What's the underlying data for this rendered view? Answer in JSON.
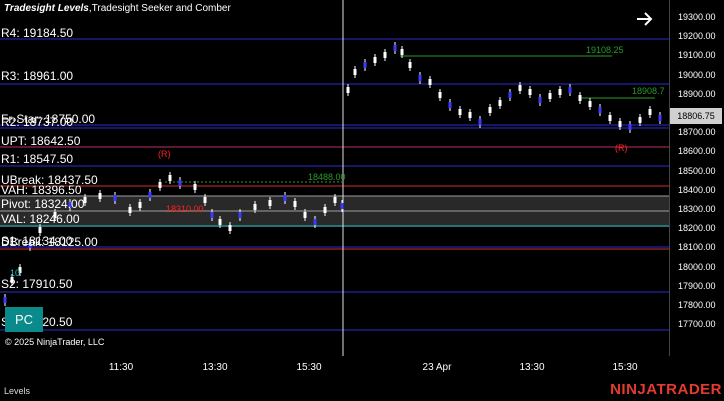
{
  "title": {
    "name": "Tradesight Levels",
    "rest": ",Tradesight Seeker and Comber"
  },
  "copyright": "© 2025 NinjaTrader, LLC",
  "pc_button": "PC",
  "tab_label": "Levels",
  "brand": "NINJATRADER",
  "current_price": "18806.75",
  "price_ticks": [
    "19300.00",
    "19200.00",
    "19100.00",
    "19000.00",
    "18900.00",
    "18800.00",
    "18700.00",
    "18600.00",
    "18500.00",
    "18400.00",
    "18300.00",
    "18200.00",
    "18100.00",
    "18000.00",
    "17900.00",
    "17800.00",
    "17700.00"
  ],
  "time_ticks": [
    "11:30",
    "13:30",
    "15:30",
    "23 Apr",
    "13:30",
    "15:30"
  ],
  "levels": [
    {
      "text": "R4: 19184.50",
      "color": "#3b3bff"
    },
    {
      "text": "R3: 18961.00",
      "color": "#3b3bff"
    },
    {
      "text": "Fr-Star: 18750.00",
      "color": "#3b3bff"
    },
    {
      "text": "R2: 18737.00",
      "color": "#3b3bff"
    },
    {
      "text": "UPT: 18642.50",
      "color": "#ff3b6b"
    },
    {
      "text": "R1: 18547.50",
      "color": "#3b3bff"
    },
    {
      "text": "UBreak: 18437.50",
      "color": "#ff3b3b"
    },
    {
      "text": "VAH: 18396.50",
      "color": "#c0c0c0"
    },
    {
      "text": "Pivot: 18324.00",
      "color": "#c0c0c0"
    },
    {
      "text": "VAL: 18246.00",
      "color": "#20c0c0"
    },
    {
      "text": "S1: 18134.00",
      "color": "#3b3bff"
    },
    {
      "text": "DBreak: 18125.00",
      "color": "#ff3b3b"
    },
    {
      "text": "S2: 17910.50",
      "color": "#3b3bff"
    },
    {
      "text": "S3: 17720.50",
      "color": "#3b3bff"
    }
  ],
  "annotations": {
    "r_marker_1": "(R)",
    "r_marker_2": "(R)",
    "green_level_1": "19108.25",
    "green_level_2": "18908.7",
    "green_level_3": "18488.00",
    "red_level": "18310.00",
    "cyan_level": "10"
  },
  "colors": {
    "support_resistance": "#3b3bff",
    "break": "#ff3b3b",
    "value_area": "#20c0c0",
    "candles": "#ffffff",
    "signal_green": "#2a9a2a",
    "signal_red": "#ff2020"
  }
}
